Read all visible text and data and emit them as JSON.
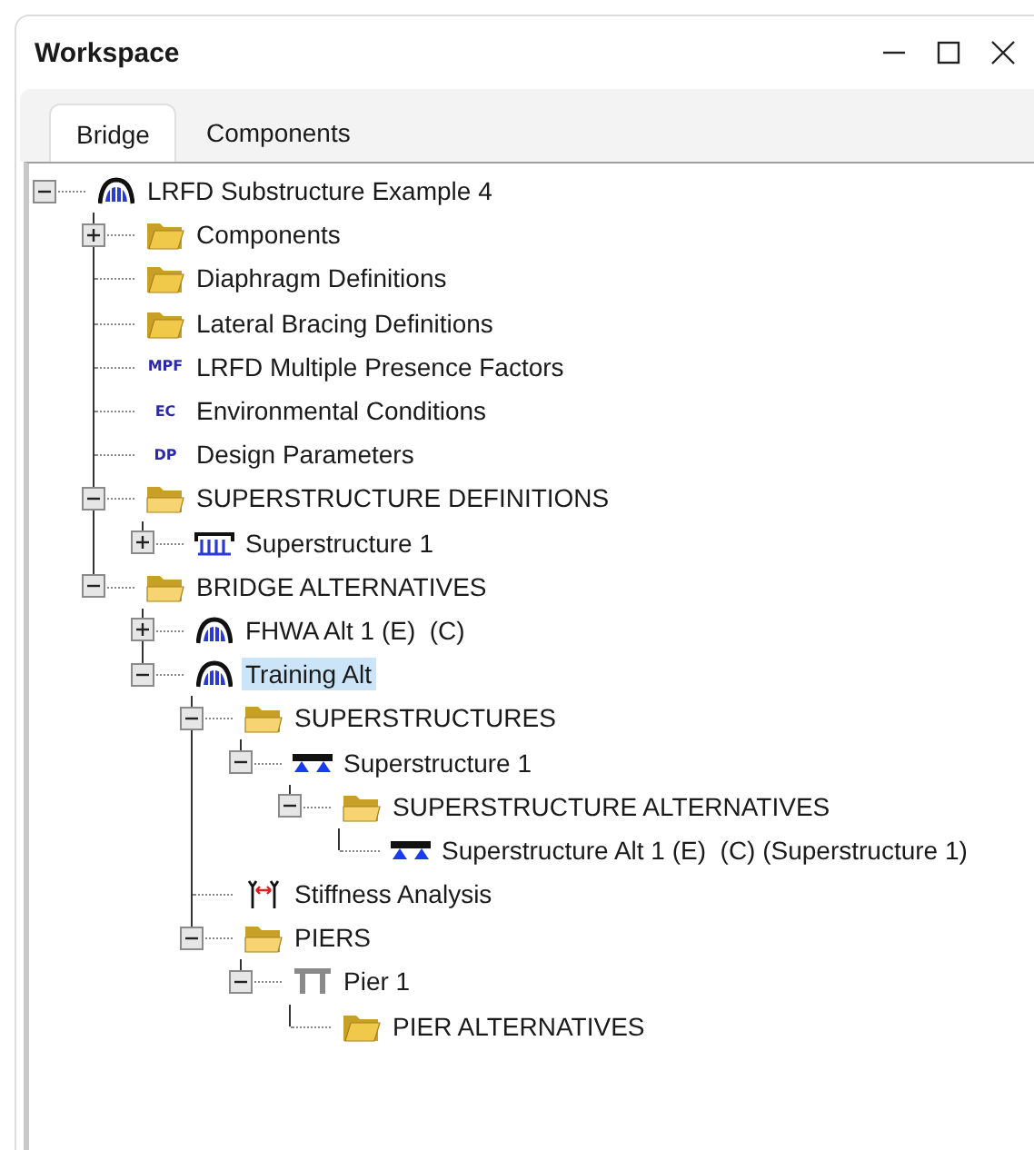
{
  "window": {
    "title": "Workspace"
  },
  "tabs": [
    {
      "label": "Bridge",
      "selected": true
    },
    {
      "label": "Components",
      "selected": false
    }
  ],
  "tree": [
    {
      "label": "LRFD Substructure Example 4",
      "kind": "arch",
      "expanded": true,
      "selected": false,
      "children": [
        {
          "label": "Components",
          "kind": "folder",
          "expanded": false,
          "selected": false
        },
        {
          "label": "Diaphragm Definitions",
          "kind": "folder",
          "selected": false
        },
        {
          "label": "Lateral Bracing Definitions",
          "kind": "folder",
          "selected": false
        },
        {
          "label": "LRFD Multiple Presence Factors",
          "kind": "badge",
          "badge": "MPF",
          "selected": false
        },
        {
          "label": "Environmental Conditions",
          "kind": "badge",
          "badge": "EC",
          "selected": false
        },
        {
          "label": "Design Parameters",
          "kind": "badge",
          "badge": "DP",
          "selected": false
        },
        {
          "label": "SUPERSTRUCTURE DEFINITIONS",
          "kind": "folder_open",
          "expanded": true,
          "selected": false,
          "children": [
            {
              "label": "Superstructure 1",
              "kind": "girder",
              "expanded": false,
              "selected": false
            }
          ]
        },
        {
          "label": "BRIDGE ALTERNATIVES",
          "kind": "folder_open",
          "expanded": true,
          "selected": false,
          "children": [
            {
              "label": "FHWA Alt 1 (E)  (C)",
              "kind": "arch",
              "expanded": false,
              "selected": false
            },
            {
              "label": "Training Alt",
              "kind": "arch",
              "expanded": true,
              "selected": true,
              "children": [
                {
                  "label": "SUPERSTRUCTURES",
                  "kind": "folder_open",
                  "expanded": true,
                  "selected": false,
                  "children": [
                    {
                      "label": "Superstructure 1",
                      "kind": "beam",
                      "expanded": true,
                      "selected": false,
                      "children": [
                        {
                          "label": "SUPERSTRUCTURE ALTERNATIVES",
                          "kind": "folder_open",
                          "expanded": true,
                          "selected": false,
                          "children": [
                            {
                              "label": "Superstructure Alt 1 (E)  (C) (Superstructure 1)",
                              "kind": "beam",
                              "selected": false
                            }
                          ]
                        }
                      ]
                    }
                  ]
                },
                {
                  "label": "Stiffness Analysis",
                  "kind": "stiffness",
                  "selected": false
                },
                {
                  "label": "PIERS",
                  "kind": "folder_open",
                  "expanded": true,
                  "selected": false,
                  "children": [
                    {
                      "label": "Pier 1",
                      "kind": "pier",
                      "expanded": true,
                      "selected": false,
                      "children": [
                        {
                          "label": "PIER ALTERNATIVES",
                          "kind": "folder",
                          "selected": false
                        }
                      ]
                    }
                  ]
                }
              ]
            }
          ]
        }
      ]
    }
  ]
}
